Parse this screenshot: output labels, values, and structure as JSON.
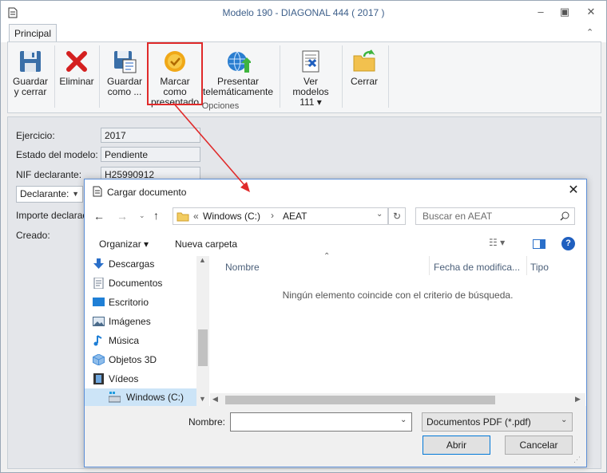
{
  "window": {
    "title": "Modelo 190 - DIAGONAL 444 ( 2017 )",
    "tab": "Principal",
    "minimize_icon": "minimize-icon",
    "restore_icon": "restore-icon",
    "close_icon": "close-icon",
    "collapse_icon": "chevron-up-icon"
  },
  "ribbon": {
    "group_label": "Opciones",
    "buttons": [
      {
        "line1": "Guardar",
        "line2": "y cerrar",
        "icon": "floppy-disk-icon"
      },
      {
        "line1": "Eliminar",
        "line2": "",
        "icon": "red-x-icon"
      },
      {
        "line1": "Guardar",
        "line2": "como ...",
        "icon": "save-as-icon"
      },
      {
        "line1": "Marcar como",
        "line2": "presentado",
        "icon": "approved-seal-icon"
      },
      {
        "line1": "Presentar",
        "line2": "telemáticamente",
        "icon": "globe-upload-icon"
      },
      {
        "line1": "Ver modelos",
        "line2": "111 ▾",
        "icon": "document-form-icon"
      },
      {
        "line1": "Cerrar",
        "line2": "",
        "icon": "folder-exit-icon"
      }
    ]
  },
  "form": {
    "ejercicio_label": "Ejercicio:",
    "ejercicio_value": "2017",
    "estado_label": "Estado del modelo:",
    "estado_value": "Pendiente",
    "nif_label": "NIF declarante:",
    "nif_value": "H25990912",
    "declarante_select": "Declarante:",
    "importe_label": "Importe declarado",
    "creado_label": "Creado:"
  },
  "dialog": {
    "title": "Cargar documento",
    "breadcrumb": [
      "Windows (C:)",
      "AEAT"
    ],
    "breadcrumb_prefix": "«",
    "search_placeholder": "Buscar en AEAT",
    "organize": "Organizar ▾",
    "new_folder": "Nueva carpeta",
    "columns": [
      "Nombre",
      "Fecha de modifica...",
      "Tipo"
    ],
    "empty_message": "Ningún elemento coincide con el criterio de búsqueda.",
    "nav_items": [
      {
        "label": "Descargas",
        "icon": "download-arrow-icon",
        "color": "#2a6fc9"
      },
      {
        "label": "Documentos",
        "icon": "documents-icon",
        "color": "#6b7a8c"
      },
      {
        "label": "Escritorio",
        "icon": "desktop-icon",
        "color": "#1f7fd6"
      },
      {
        "label": "Imágenes",
        "icon": "pictures-icon",
        "color": "#4a6a8a"
      },
      {
        "label": "Música",
        "icon": "music-note-icon",
        "color": "#1f7fd6"
      },
      {
        "label": "Objetos 3D",
        "icon": "cube-3d-icon",
        "color": "#4a90d9"
      },
      {
        "label": "Vídeos",
        "icon": "film-strip-icon",
        "color": "#333333"
      },
      {
        "label": "Windows (C:)",
        "icon": "drive-icon",
        "color": "#5a6b7c"
      }
    ],
    "filename_label": "Nombre:",
    "filename_value": "",
    "filetype": "Documentos PDF (*.pdf)",
    "open_button": "Abrir",
    "cancel_button": "Cancelar"
  }
}
